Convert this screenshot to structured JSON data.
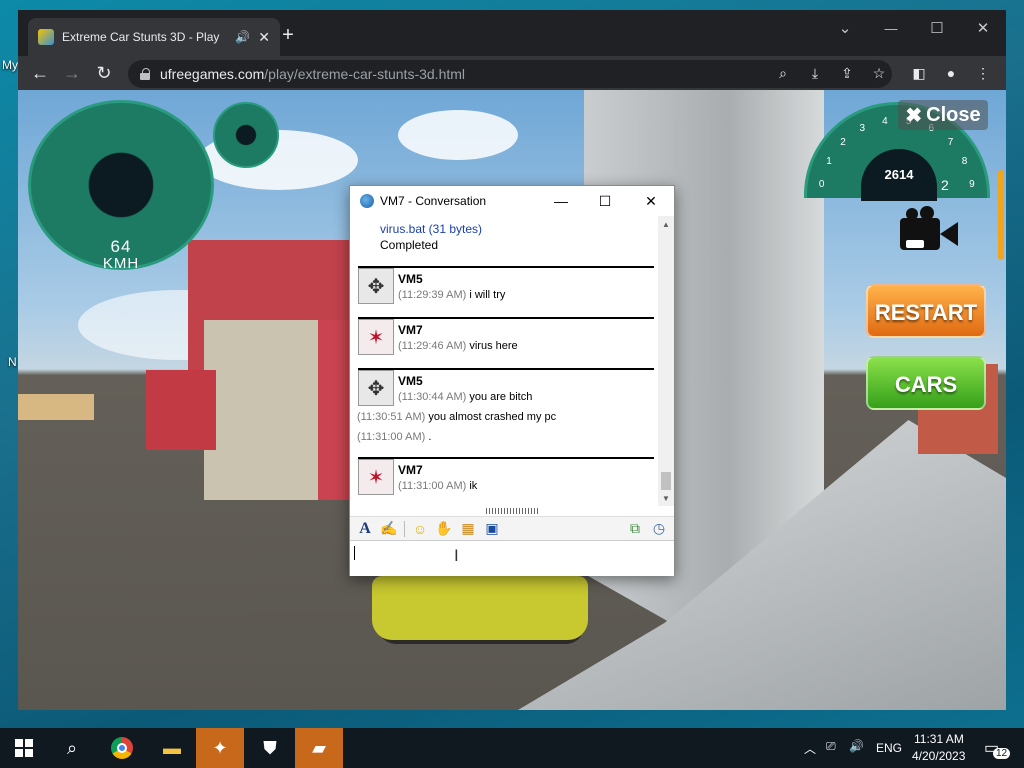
{
  "desktop": {
    "icon_labels": [
      "My",
      "N"
    ]
  },
  "browser": {
    "tab": {
      "title": "Extreme Car Stunts 3D - Play",
      "audio_icon": "speaker-icon",
      "close": "✕"
    },
    "newtab": "+",
    "window": {
      "minimize": "⌄",
      "maximize": "☐",
      "close": "✕"
    },
    "url": {
      "host": "ufreegames.com",
      "path": "/play/extreme-car-stunts-3d.html"
    }
  },
  "game": {
    "speedometer": {
      "value": "64",
      "unit": "KMH"
    },
    "rpm": {
      "value": "2614",
      "gear": "2",
      "ticks": [
        "0",
        "1",
        "2",
        "3",
        "4",
        "5",
        "6",
        "7",
        "8",
        "9"
      ]
    },
    "close_label": "Close",
    "restart_label": "RESTART",
    "cars_label": "CARS"
  },
  "conversation": {
    "title": "VM7 - Conversation",
    "file": "virus.bat (31 bytes)",
    "file_status": "Completed",
    "messages": [
      {
        "name": "VM5",
        "lines": [
          {
            "ts": "(11:29:39 AM)",
            "text": "i will try"
          }
        ]
      },
      {
        "name": "VM7",
        "lines": [
          {
            "ts": "(11:29:46 AM)",
            "text": "virus here"
          }
        ]
      },
      {
        "name": "VM5",
        "lines": [
          {
            "ts": "(11:30:44 AM)",
            "text": "you are bitch"
          },
          {
            "ts": "(11:30:51 AM)",
            "text": "you almost crashed my pc"
          },
          {
            "ts": "(11:31:00 AM)",
            "text": "."
          }
        ]
      },
      {
        "name": "VM7",
        "lines": [
          {
            "ts": "(11:31:00 AM)",
            "text": "ik"
          }
        ]
      }
    ],
    "input_value": ""
  },
  "taskbar": {
    "language": "ENG",
    "time": "11:31 AM",
    "date": "4/20/2023",
    "notification_count": "12"
  },
  "colors": {
    "accent": "#c8681a",
    "restart": "#f28a24",
    "cars": "#4fbf2a",
    "gauge": "#1d7a63"
  }
}
